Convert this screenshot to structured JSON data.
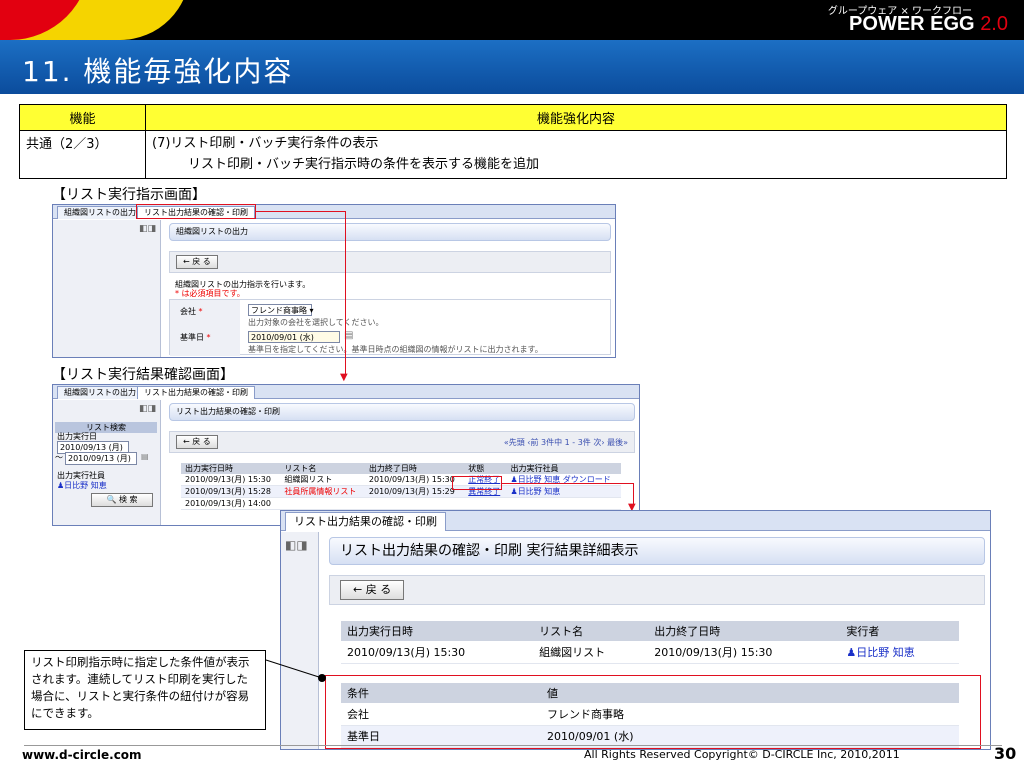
{
  "brand": {
    "subtitle": "グループウェア × ワークフロー",
    "name": "POWER EGG",
    "version": "2.0"
  },
  "slide_title": "11. 機能毎強化内容",
  "summary_table": {
    "headers": [
      "機能",
      "機能強化内容"
    ],
    "row": {
      "feature": "共通（2／3）",
      "line1": "(7)リスト印刷・バッチ実行条件の表示",
      "line2": "リスト印刷・バッチ実行指示時の条件を表示する機能を追加"
    }
  },
  "section1_title": "【リスト実行指示画面】",
  "section2_title": "【リスト実行結果確認画面】",
  "win1": {
    "tabs": [
      "組織図リストの出力",
      "リスト出力結果の確認・印刷"
    ],
    "header": "組織図リストの出力",
    "back_label": "← 戻 る",
    "intro1": "組織図リストの出力指示を行います。",
    "intro2": "* は必須項目です。",
    "company_label": "会社",
    "company_value": "フレンド商事略",
    "company_hint": "出力対象の会社を選択してください。",
    "date_label": "基準日",
    "date_value": "2010/09/01 (水)",
    "date_hint": "基準日を指定してください。基準日時点の組織図の情報がリストに出力されます。",
    "required_mark": "*"
  },
  "win2": {
    "tabs": [
      "組織図リストの出力",
      "リスト出力結果の確認・印刷"
    ],
    "left": {
      "search_title": "リスト検索",
      "exec_date_label": "出力実行日",
      "date_from": "2010/09/13 (月)",
      "date_to": "2010/09/13 (月)",
      "tilde": "～",
      "exec_user_label": "出力実行社員",
      "exec_user": "日比野 知恵",
      "search_button": "検 索"
    },
    "header": "リスト出力結果の確認・印刷",
    "back_label": "← 戻 る",
    "pager": "«先頭 ‹前 3件中 1 - 3件 次› 最後»",
    "columns": [
      "出力実行日時",
      "リスト名",
      "出力終了日時",
      "状態",
      "出力実行社員"
    ],
    "rows": [
      {
        "start": "2010/09/13(月) 15:30",
        "name": "組織図リスト",
        "end": "2010/09/13(月) 15:30",
        "status": "正常終了",
        "user": "日比野 知恵",
        "extra": "ダウンロード"
      },
      {
        "start": "2010/09/13(月) 15:28",
        "name": "社員所属情報リスト",
        "end": "2010/09/13(月) 15:29",
        "status": "異常終了",
        "user": "日比野 知恵",
        "extra": ""
      },
      {
        "start": "2010/09/13(月) 14:00",
        "name": "",
        "end": "",
        "status": "",
        "user": "",
        "extra": ""
      }
    ]
  },
  "win3": {
    "tab": "リスト出力結果の確認・印刷",
    "header": "リスト出力結果の確認・印刷  実行結果詳細表示",
    "back_label": "← 戻 る",
    "columns": [
      "出力実行日時",
      "リスト名",
      "出力終了日時",
      "実行者"
    ],
    "row": {
      "start": "2010/09/13(月) 15:30",
      "name": "組織図リスト",
      "end": "2010/09/13(月) 15:30",
      "user": "日比野  知恵"
    },
    "cond_columns": [
      "条件",
      "値"
    ],
    "cond_rows": [
      {
        "key": "会社",
        "value": "フレンド商事略"
      },
      {
        "key": "基準日",
        "value": "2010/09/01 (水)"
      }
    ]
  },
  "callout": "リスト印刷指示時に指定した条件値が表示されます。連続してリスト印刷を実行した場合に、リストと実行条件の紐付けが容易にできます。",
  "footer": {
    "url": "www.d-circle.com",
    "copyright": "All Rights Reserved Copyright© D-CIRCLE  Inc, 2010,2011",
    "page": "30"
  },
  "colors": {
    "title_blue": "#0b4c9c",
    "header_yellow": "#ffff33",
    "accent_red": "#e01020"
  }
}
